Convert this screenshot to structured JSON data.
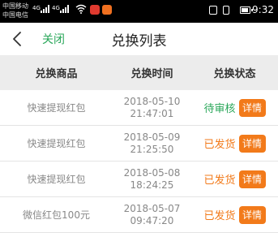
{
  "status_bar": {
    "carrier_line1": "中国移动",
    "carrier_line2": "中国电信",
    "signal_label": "4G",
    "time": "9:32"
  },
  "nav": {
    "back_icon": "chevron-left-icon",
    "close_label": "关闭",
    "title": "兑换列表"
  },
  "table": {
    "headers": [
      "兑换商品",
      "兑换时间",
      "兑换状态"
    ],
    "rows": [
      {
        "name": "快速提现红包",
        "date": "2018-05-10",
        "time": "21:47:01",
        "status": "待审核",
        "status_color": "#2aa75a",
        "action": "详情"
      },
      {
        "name": "快速提现红包",
        "date": "2018-05-09",
        "time": "21:25:50",
        "status": "已发货",
        "status_color": "#f27a1a",
        "action": "详情"
      },
      {
        "name": "快速提现红包",
        "date": "2018-05-08",
        "time": "18:24:25",
        "status": "已发货",
        "status_color": "#f27a1a",
        "action": "详情"
      },
      {
        "name": "微信红包100元",
        "date": "2018-05-07",
        "time": "09:47:20",
        "status": "已发货",
        "status_color": "#f27a1a",
        "action": "详情"
      }
    ]
  },
  "colors": {
    "accent_green": "#2aa75a",
    "accent_orange": "#f27a1a",
    "header_bg": "#ececec"
  }
}
